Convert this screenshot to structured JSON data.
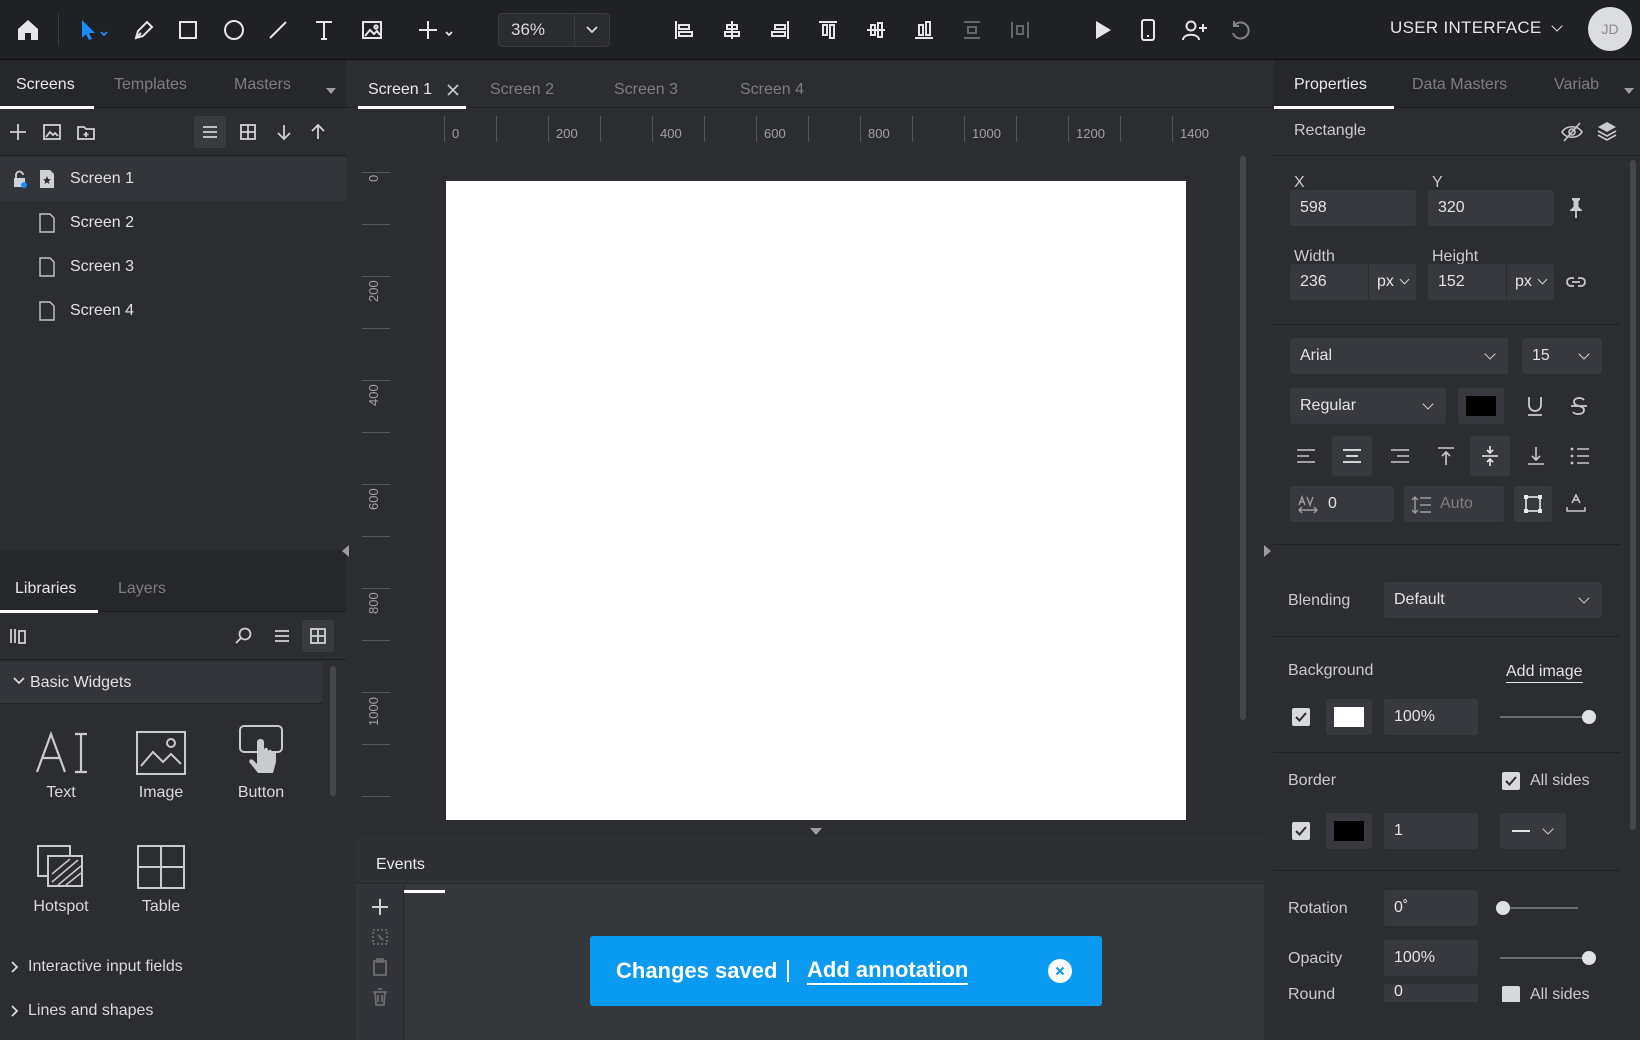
{
  "toolbar": {
    "zoom_value": "36%",
    "project_name": "USER INTERFACE",
    "avatar_initials": "JD",
    "accent_color": "#0a9af2"
  },
  "left_panel": {
    "top_tabs": [
      {
        "label": "Screens"
      },
      {
        "label": "Templates"
      },
      {
        "label": "Masters"
      }
    ],
    "screens": [
      {
        "label": "Screen 1"
      },
      {
        "label": "Screen 2"
      },
      {
        "label": "Screen 3"
      },
      {
        "label": "Screen 4"
      }
    ],
    "bottom_tabs": [
      {
        "label": "Libraries"
      },
      {
        "label": "Layers"
      }
    ],
    "section_title": "Basic Widgets",
    "widgets": [
      {
        "label": "Text"
      },
      {
        "label": "Image"
      },
      {
        "label": "Button"
      },
      {
        "label": "Hotspot"
      },
      {
        "label": "Table"
      }
    ],
    "collapsed_sections": [
      {
        "label": "Interactive input fields"
      },
      {
        "label": "Lines and shapes"
      }
    ]
  },
  "center": {
    "screen_tabs": [
      {
        "label": "Screen 1"
      },
      {
        "label": "Screen 2"
      },
      {
        "label": "Screen 3"
      },
      {
        "label": "Screen 4"
      }
    ],
    "ruler_h_labels": [
      "0",
      "200",
      "400",
      "600",
      "800",
      "1000",
      "1200",
      "1400"
    ],
    "ruler_v_labels": [
      "0",
      "200",
      "400",
      "600",
      "800",
      "1000"
    ],
    "events_tab": "Events",
    "toast": {
      "message": "Changes saved",
      "separator": "|",
      "link": "Add annotation"
    }
  },
  "right_panel": {
    "tabs": [
      {
        "label": "Properties"
      },
      {
        "label": "Data Masters"
      },
      {
        "label": "Variab"
      }
    ],
    "element_type": "Rectangle",
    "x_label": "X",
    "x_value": "598",
    "y_label": "Y",
    "y_value": "320",
    "width_label": "Width",
    "width_value": "236",
    "width_unit": "px",
    "height_label": "Height",
    "height_value": "152",
    "height_unit": "px",
    "font_family": "Arial",
    "font_size": "15",
    "font_style": "Regular",
    "text_color": "#000000",
    "letter_spacing": "0",
    "line_height_placeholder": "Auto",
    "blending_label": "Blending",
    "blending_value": "Default",
    "background_label": "Background",
    "add_image": "Add image",
    "background_color": "#ffffff",
    "background_opacity": "100%",
    "border_label": "Border",
    "all_sides": "All sides",
    "border_color": "#000000",
    "border_width": "1",
    "rotation_label": "Rotation",
    "rotation_value": "0˚",
    "opacity_label": "Opacity",
    "opacity_value": "100%",
    "round_label": "Round",
    "round_value": "0",
    "round_all_sides": "All sides"
  }
}
